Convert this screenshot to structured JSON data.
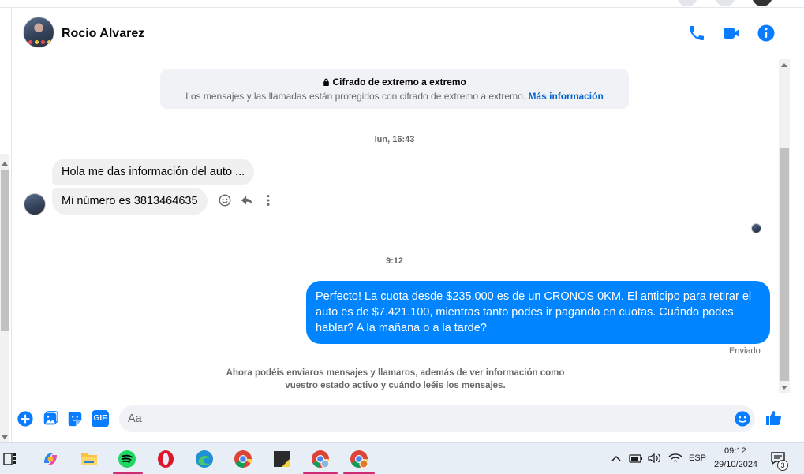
{
  "contact": {
    "name": "Rocio Alvarez"
  },
  "e2e": {
    "title": "Cifrado de extremo a extremo",
    "body": "Los mensajes y las llamadas están protegidos con cifrado de extremo a extremo.",
    "link": "Más información"
  },
  "messages": {
    "timestamp_1": "lun, 16:43",
    "in_1": "Hola me das información del auto ...",
    "in_2": "Mi número es 3813464635",
    "timestamp_2": "9:12",
    "out_1": "Perfecto! La cuota desde $235.000 es de un CRONOS 0KM. El anticipo para retirar el auto es de $7.421.100, mientras tanto podes ir pagando en cuotas. Cuándo podes hablar? A la mañana o a la tarde?",
    "status": "Enviado"
  },
  "notice": "Ahora podéis enviaros mensajes y llamaros, además de ver información como vuestro estado activo y cuándo leéis los mensajes.",
  "composer": {
    "placeholder": "Aa",
    "gif_label": "GIF"
  },
  "taskbar": {
    "lang": "ESP",
    "time": "09:12",
    "date": "29/10/2024",
    "notif_count": "3"
  },
  "colors": {
    "accent": "#0084ff",
    "link": "#0064d1",
    "icon": "#0a7cff"
  }
}
